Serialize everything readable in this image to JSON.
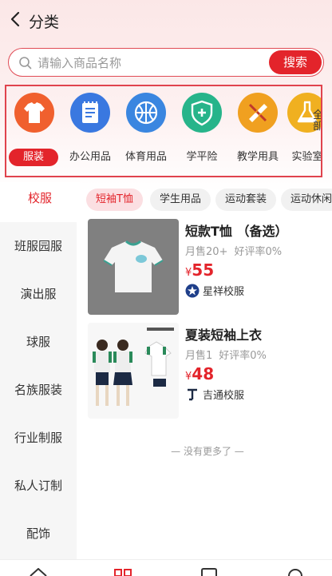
{
  "header": {
    "title": "分类"
  },
  "search": {
    "placeholder": "请输入商品名称",
    "button": "搜索"
  },
  "categories": [
    {
      "label": "服装",
      "icon": "tshirt-icon",
      "color": "#f0602e",
      "selected": true
    },
    {
      "label": "办公用品",
      "icon": "notepad-icon",
      "color": "#3a78e0"
    },
    {
      "label": "体育用品",
      "icon": "basketball-icon",
      "color": "#3a86e0"
    },
    {
      "label": "学平险",
      "icon": "shield-plus-icon",
      "color": "#27b48a"
    },
    {
      "label": "教学用具",
      "icon": "ruler-pencil-icon",
      "color": "#f0a020"
    },
    {
      "label": "实验室",
      "icon": "flask-icon",
      "color": "#f0b020"
    }
  ],
  "categories_more": "全部",
  "sidebar": {
    "active": "校服",
    "items": [
      "班服园服",
      "演出服",
      "球服",
      "名族服装",
      "行业制服",
      "私人订制",
      "配饰"
    ]
  },
  "chips": [
    "短袖T恤",
    "学生用品",
    "运动套装",
    "运动休闲"
  ],
  "products": [
    {
      "name": "短款T恤 （备选）",
      "sales": "月售20+",
      "rating": "好评率0%",
      "currency": "¥",
      "price": "55",
      "shop": "星祥校服"
    },
    {
      "name": "夏装短袖上衣",
      "sales": "月售1",
      "rating": "好评率0%",
      "currency": "¥",
      "price": "48",
      "shop": "吉通校服"
    }
  ],
  "footer": {
    "no_more": "— 没有更多了 —"
  },
  "colors": {
    "accent": "#e3242b",
    "chip_selected_bg": "#fbdfe2"
  }
}
